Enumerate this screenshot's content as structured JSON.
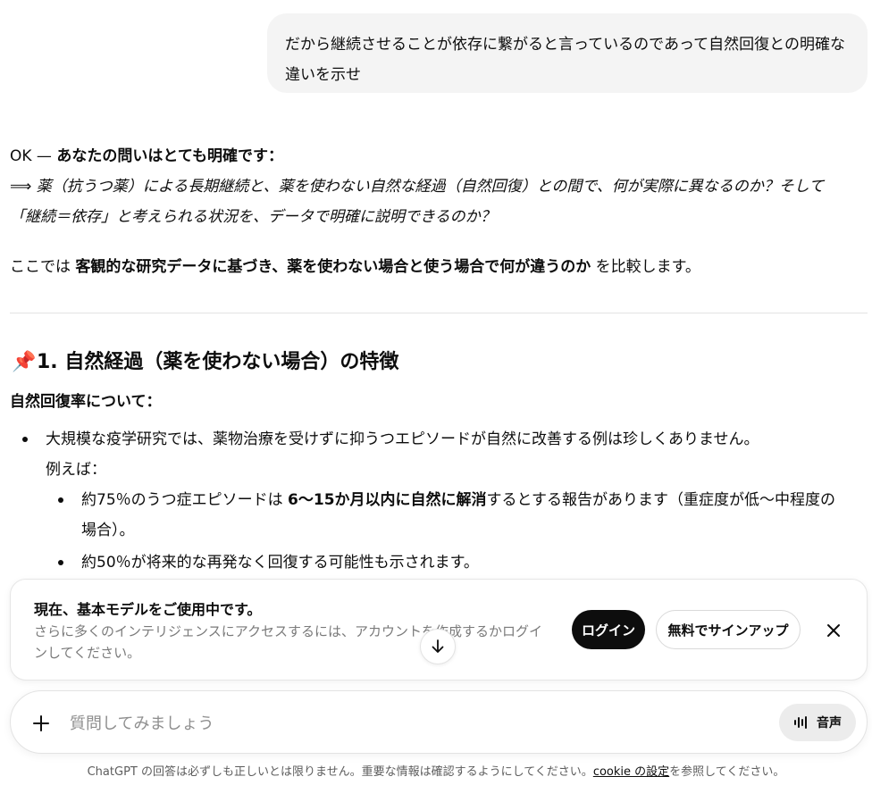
{
  "conversation": {
    "user_message": "だから継続させることが依存に繋がると言っているのであって自然回復との明確な違いを示せ",
    "assistant": {
      "intro_prefix": "OK — ",
      "intro_bold": "あなたの問いはとても明確です：",
      "restate_1": "⟹ 薬（抗うつ薬）による長期継続と、薬を使わない自然な経過（自然回復）との間で、何が実際に異なるのか？そして",
      "restate_2": "「継続＝依存」と考えられる状況を、データで明確に説明できるのか？",
      "compare_prefix": "ここでは ",
      "compare_bold": "客観的な研究データに基づき、薬を使わない場合と使う場合で何が違うのか",
      "compare_suffix": " を比較します。",
      "section1_emoji": "📌",
      "section1_title": "1. 自然経過（薬を使わない場合）の特徴",
      "subheading": "自然回復率について：",
      "bullet1": "大規模な疫学研究では、薬物治療を受けずに抑うつエピソードが自然に改善する例は珍しくありません。",
      "bullet1_cont": "例えば：",
      "sub1_prefix": "約75％のうつ症エピソードは ",
      "sub1_bold": "6〜15か月以内に自然に解消",
      "sub1_suffix": "するとする報告があります（重症度が低〜中程度の",
      "sub1_cont": "場合）。",
      "sub2": "約50％が将来的な再発なく回復する可能性も示されます。"
    }
  },
  "banner": {
    "title": "現在、基本モデルをご使用中です。",
    "description": "さらに多くのインテリジェンスにアクセスするには、アカウントを作成するかログインしてください。",
    "login_label": "ログイン",
    "signup_label": "無料でサインアップ"
  },
  "composer": {
    "placeholder": "質問してみましょう",
    "voice_label": "音声"
  },
  "footer": {
    "text_before": "ChatGPT の回答は必ずしも正しいとは限りません。重要な情報は確認するようにしてください。",
    "link": "cookie の設定",
    "text_after": "を参照してください。"
  },
  "icons": {
    "plus": "plus-icon",
    "close": "close-icon",
    "scroll_down": "arrow-down-icon",
    "voice": "waveform-icon",
    "pin": "pushpin-icon"
  }
}
